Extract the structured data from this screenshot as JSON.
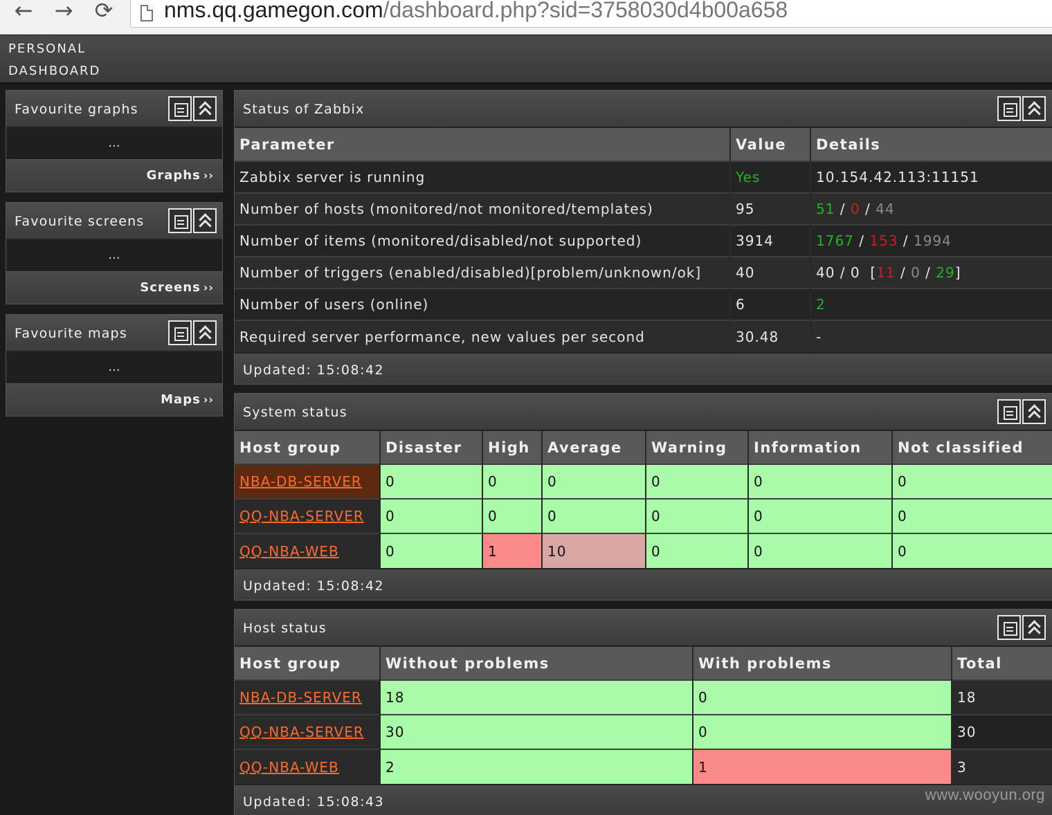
{
  "browser": {
    "back_icon": "←",
    "forward_icon": "→",
    "reload_icon": "⟳",
    "url_host": "nms.qq.gamegon.com",
    "url_path": "/dashboard.php?sid=3758030d4b00a658"
  },
  "header": {
    "title_line1": "PERSONAL",
    "title_line2": "DASHBOARD"
  },
  "favourites": [
    {
      "title": "Favourite graphs",
      "dots": "...",
      "link": "Graphs",
      "chev": "››"
    },
    {
      "title": "Favourite screens",
      "dots": "...",
      "link": "Screens",
      "chev": "››"
    },
    {
      "title": "Favourite maps",
      "dots": "...",
      "link": "Maps",
      "chev": "››"
    }
  ],
  "zabbix_status": {
    "title": "Status of Zabbix",
    "headers": [
      "Parameter",
      "Value",
      "Details"
    ],
    "rows": [
      {
        "param": "Zabbix server is running",
        "value": "Yes",
        "details": [
          "10.154.42.113:11151"
        ]
      },
      {
        "param": "Number of hosts (monitored/not monitored/templates)",
        "value": "95",
        "details": [
          "51",
          " / ",
          "0",
          " / ",
          "44"
        ]
      },
      {
        "param": "Number of items (monitored/disabled/not supported)",
        "value": "3914",
        "details": [
          "1767",
          " / ",
          "153",
          " / ",
          "1994"
        ]
      },
      {
        "param": "Number of triggers (enabled/disabled)[problem/unknown/ok]",
        "value": "40",
        "details": [
          "40 / 0  [",
          "11",
          " / ",
          "0",
          " / ",
          "29",
          "]"
        ]
      },
      {
        "param": "Number of users (online)",
        "value": "6",
        "details": [
          "2"
        ]
      },
      {
        "param": "Required server performance, new values per second",
        "value": "30.48",
        "details": [
          "-"
        ]
      }
    ],
    "updated": "Updated: 15:08:42"
  },
  "system_status": {
    "title": "System status",
    "headers": [
      "Host group",
      "Disaster",
      "High",
      "Average",
      "Warning",
      "Information",
      "Not classified"
    ],
    "rows": [
      {
        "group": "NBA-DB-SERVER",
        "values": [
          "0",
          "0",
          "0",
          "0",
          "0",
          "0"
        ]
      },
      {
        "group": "QQ-NBA-SERVER",
        "values": [
          "0",
          "0",
          "0",
          "0",
          "0",
          "0"
        ]
      },
      {
        "group": "QQ-NBA-WEB",
        "values": [
          "0",
          "1",
          "10",
          "0",
          "0",
          "0"
        ]
      }
    ],
    "updated": "Updated: 15:08:42"
  },
  "host_status": {
    "title": "Host status",
    "headers": [
      "Host group",
      "Without problems",
      "With problems",
      "Total"
    ],
    "rows": [
      {
        "group": "NBA-DB-SERVER",
        "values": [
          "18",
          "0",
          "18"
        ]
      },
      {
        "group": "QQ-NBA-SERVER",
        "values": [
          "30",
          "0",
          "30"
        ]
      },
      {
        "group": "QQ-NBA-WEB",
        "values": [
          "2",
          "1",
          "3"
        ]
      }
    ],
    "updated": "Updated: 15:08:43"
  },
  "watermark": "www.wooyun.org",
  "colors": {
    "ok_cell": "#a8fca8",
    "problem_cell": "#fb8a8a",
    "average_cell": "#d9a6a6",
    "link": "#ff6a2a",
    "green_text": "#22b422",
    "red_text": "#c81e1e"
  }
}
